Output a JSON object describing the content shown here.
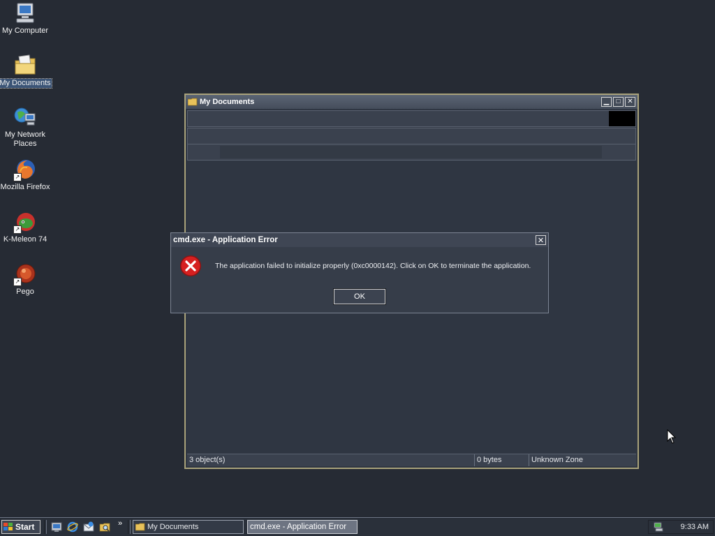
{
  "desktop": {
    "icons": [
      {
        "label": "My Computer",
        "icon": "computer-icon"
      },
      {
        "label": "My Documents",
        "icon": "folder-icon",
        "selected": true
      },
      {
        "label": "My Network Places",
        "icon": "network-icon"
      },
      {
        "label": "Mozilla Firefox",
        "icon": "firefox-icon",
        "shortcut": true
      },
      {
        "label": "K-Meleon 74",
        "icon": "kmeleon-icon",
        "shortcut": true
      },
      {
        "label": "Pego",
        "icon": "pego-icon",
        "shortcut": true
      }
    ]
  },
  "explorer": {
    "title": "My Documents",
    "status": {
      "objects": "3 object(s)",
      "size": "0 bytes",
      "zone": "Unknown Zone"
    }
  },
  "dialog": {
    "title": "cmd.exe - Application Error",
    "message": "The application failed to initialize properly (0xc0000142). Click on OK to terminate the application.",
    "ok_label": "OK"
  },
  "taskbar": {
    "start_label": "Start",
    "buttons": [
      {
        "label": "My Documents",
        "active": false
      },
      {
        "label": "cmd.exe - Application Error",
        "active": true
      }
    ],
    "chevron": "»",
    "clock": "9:33 AM"
  },
  "colors": {
    "desktop_bg": "#262b34",
    "window_border": "#a9a27a",
    "error_red": "#d62020"
  }
}
